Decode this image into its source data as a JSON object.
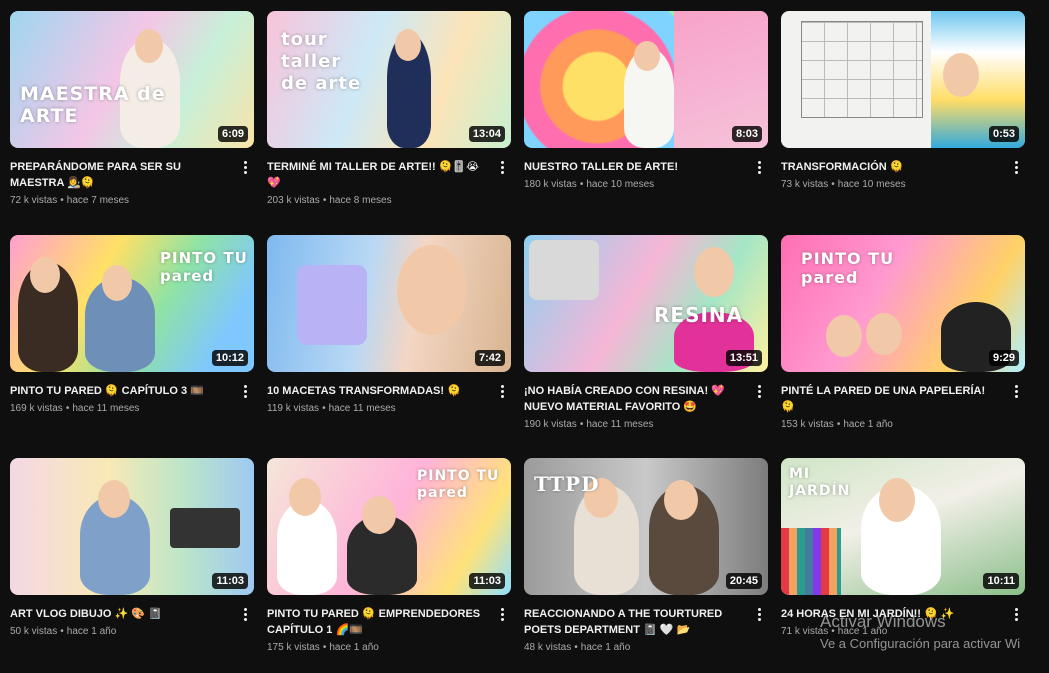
{
  "videos": [
    {
      "title": "PREPARÁNDOME PARA SER SU MAESTRA 👩‍🎨🫠",
      "views": "72 k vistas",
      "age": "hace 7 meses",
      "duration": "6:09",
      "overlay": "MAESTRA de ARTE"
    },
    {
      "title": "TERMINÉ MI TALLER DE ARTE!! 🫠🎚️😭 💖",
      "views": "203 k vistas",
      "age": "hace 8 meses",
      "duration": "13:04",
      "overlay": "tour taller de arte"
    },
    {
      "title": "NUESTRO TALLER DE ARTE!",
      "views": "180 k vistas",
      "age": "hace 10 meses",
      "duration": "8:03",
      "overlay": ""
    },
    {
      "title": "TRANSFORMACIÓN 🫠",
      "views": "73 k vistas",
      "age": "hace 10 meses",
      "duration": "0:53",
      "overlay": ""
    },
    {
      "title": "PINTO TU PARED 🫠 CAPÍTULO 3 🎞️",
      "views": "169 k vistas",
      "age": "hace 11 meses",
      "duration": "10:12",
      "overlay": "PINTO TU pared"
    },
    {
      "title": "10 MACETAS TRANSFORMADAS! 🫠",
      "views": "119 k vistas",
      "age": "hace 11 meses",
      "duration": "7:42",
      "overlay": ""
    },
    {
      "title": "¡NO HABÍA CREADO CON RESINA! 💖 NUEVO MATERIAL FAVORITO 🤩",
      "views": "190 k vistas",
      "age": "hace 11 meses",
      "duration": "13:51",
      "overlay": "RESINA"
    },
    {
      "title": "PINTÉ LA PARED DE UNA PAPELERÍA! 🫠",
      "views": "153 k vistas",
      "age": "hace 1 año",
      "duration": "9:29",
      "overlay": "PINTO TU pared"
    },
    {
      "title": "ART VLOG DIBUJO ✨ 🎨 📓",
      "views": "50 k vistas",
      "age": "hace 1 año",
      "duration": "11:03",
      "overlay": ""
    },
    {
      "title": "PINTO TU PARED 🫠 EMPRENDEDORES CAPÍTULO 1 🌈🎞️",
      "views": "175 k vistas",
      "age": "hace 1 año",
      "duration": "11:03",
      "overlay": "PINTO TU pared"
    },
    {
      "title": "REACCIONANDO A THE TOURTURED POETS DEPARTMENT 📓 🤍 📂",
      "views": "48 k vistas",
      "age": "hace 1 año",
      "duration": "20:45",
      "overlay": "TTPD"
    },
    {
      "title": "24 HORAS EN MI JARDÍN!! 🫠 ✨",
      "views": "71 k vistas",
      "age": "hace 1 año",
      "duration": "10:11",
      "overlay": "MI JARDÍN"
    }
  ],
  "watermark": {
    "line1": "Activar Windows",
    "line2": "Ve a Configuración para activar Wi"
  },
  "colors": {
    "background": "#0f0f0f",
    "title": "#f1f1f1",
    "meta": "#aaaaaa",
    "badge": "#000000"
  }
}
